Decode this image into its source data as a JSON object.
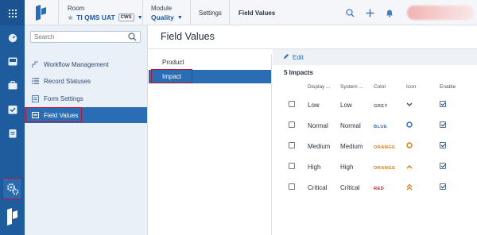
{
  "header": {
    "room_label": "Room",
    "room_value": "TI QMS UAT",
    "room_badge": "CWS",
    "module_label": "Module",
    "module_value": "Quality",
    "crumb_settings": "Settings",
    "crumb_field_values": "Field Values"
  },
  "nav": {
    "search_placeholder": "Search",
    "items": [
      {
        "label": "Workflow Management",
        "icon": "workflow-icon"
      },
      {
        "label": "Record Statuses",
        "icon": "list-icon"
      },
      {
        "label": "Form Settings",
        "icon": "form-icon"
      },
      {
        "label": "Field Values",
        "icon": "field-values-icon"
      }
    ]
  },
  "main": {
    "title": "Field Values",
    "value_types": [
      "Product",
      "Impact"
    ],
    "edit_label": "Edit",
    "count_label": "5 Impacts",
    "columns": [
      "Display ...",
      "System ...",
      "Color",
      "Icon",
      "Enable"
    ],
    "rows": [
      {
        "display": "Low",
        "system": "Low",
        "color": "GREY",
        "color_hex": "#5c6670",
        "icon": "chevron-down-icon",
        "enabled": true
      },
      {
        "display": "Normal",
        "system": "Normal",
        "color": "BLUE",
        "color_hex": "#2f6fc0",
        "icon": "circle-icon",
        "enabled": true
      },
      {
        "display": "Medium",
        "system": "Medium",
        "color": "ORANGE",
        "color_hex": "#e07a10",
        "icon": "circle-icon",
        "enabled": true
      },
      {
        "display": "High",
        "system": "High",
        "color": "ORANGE",
        "color_hex": "#e07a10",
        "icon": "chevron-up-icon",
        "enabled": true
      },
      {
        "display": "Critical",
        "system": "Critical",
        "color": "RED",
        "color_hex": "#d42020",
        "icon": "double-chevron-up-icon",
        "enabled": true
      }
    ]
  },
  "colors": {
    "accent": "#2a6db5",
    "rail": "#1f5c9e",
    "highlight_box": "#c0152f"
  }
}
